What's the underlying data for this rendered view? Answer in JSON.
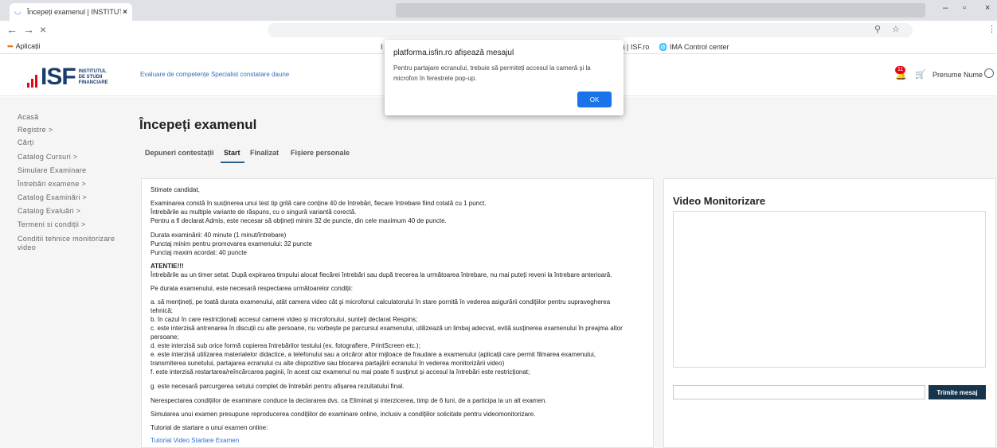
{
  "browser": {
    "tab_title": "Începeți examenul | INSTITUTUL",
    "tab_close": "×",
    "back": "←",
    "forward": "→",
    "stop": "×",
    "zoom_icon": "⚲",
    "star_icon": "☆",
    "menu_icon": "⋮",
    "win_min": "–",
    "win_max": "▫",
    "win_close": "×"
  },
  "bookmarks": {
    "apps_label": "Aplicații",
    "left_fragment": "I",
    "right_fragment": "ază | ISF.ro",
    "ima_label": "IMA Control center"
  },
  "header": {
    "logo_text": "ISF",
    "logo_line1": "INSTITUTUL",
    "logo_line2": "DE STUDII",
    "logo_line3": "FINANCIARE",
    "subtitle": "Evaluare de competențe Specialist constatare daune",
    "notification_count": "11",
    "user_name": "Prenume Nume"
  },
  "sidebar": {
    "items": [
      "Acasă",
      "Registre >",
      "Cărți",
      "Catalog Cursuri >",
      "Simulare Examinare",
      "Întrebări examene >",
      "Catalog Examinări >",
      "Catalog Evaluări >",
      "Termeni si condiții >",
      "Conditii tehnice monitorizare",
      "video"
    ]
  },
  "page": {
    "title": "Începeți examenul",
    "tabs": [
      "Depuneri contestații",
      "Start",
      "Finalizat",
      "Fișiere personale"
    ],
    "active_tab": "Start"
  },
  "instructions": {
    "lines": [
      "Stimate candidat,",
      "Examinarea constă în susținerea unui test tip grilă care conține 40 de întrebări, fiecare întrebare fiind cotată cu 1 punct.",
      "Întrebările au multiple variante de răspuns, cu o singură variantă corectă.",
      "Pentru a fi declarat Admis, este necesar să obțineți minim 32 de puncte, din cele maximum 40 de puncte.",
      "Durata examinării: 40 minute (1 minut/întrebare)",
      "Punctaj minim pentru promovarea examenului: 32 puncte",
      "Punctaj maxim acordat: 40 puncte",
      "ATENTIE!!!",
      "Întrebările au un timer setat. După expirarea timpului alocat fiecărei întrebări sau după trecerea la următoarea întrebare, nu mai puteți reveni la întrebare anterioară.",
      "Pe durata examenului, este necesară respectarea următoarelor condiții:",
      "a. să mențineți, pe toată durata examenului, atât camera video cât și microfonul calculatorului în stare pornită în vederea asigurării condițiilor pentru supravegherea",
      "tehnică;",
      "b. în cazul în care  restricționați accesul camerei video și microfonului, sunteți declarat Respins;",
      "c. este interzisă antrenarea în discuții cu alte persoane, nu vorbește pe parcursul examenului, utilizează un limbaj adecvat, evită susținerea examenului în preajma altor",
      "persoane;",
      "d. este interzisă sub orice formă copierea întrebărilor testului (ex. fotografiere, PrintScreen etc.);",
      "e. este interzisă utilizarea materialelor didactice, a telefonului sau a oricăror altor mijloace de fraudare a examenului (aplicații care permit filmarea examenului,",
      "transmiterea sunetului, partajarea ecranului cu alte dispozitive sau blocarea partajării ecranului în vederea monitorizării video)",
      "f. este interzisă restartarea/reîncărcarea paginii, în acest caz examenul nu mai poate fi susținut și accesul la întrebări este restricționat;",
      "g. este necesară parcurgerea setului complet de întrebări pentru afișarea rezultatului final.",
      "Nerespectarea condițiilor de examinare conduce la declararea dvs. ca Eliminat și interzicerea, timp de 6 luni, de a participa la un alt examen.",
      "Simularea unui examen presupune reproducerea condițiilor de examinare online, inclusiv a condițiilor solicitate pentru videomonitorizare.",
      "Tutorial de startare a unui examen online:",
      "Tutorial Video Startare Examen"
    ]
  },
  "video": {
    "title": "Video Monitorizare",
    "message_placeholder": "",
    "send_label": "Trimite mesaj"
  },
  "dialog": {
    "title": "platforma.isfin.ro afișează mesajul",
    "message_line1": "Pentru partajare ecranului, trebuie să permiteți accesul la cameră și la",
    "message_line2": "microfon în ferestrele pop-up.",
    "ok_label": "OK"
  },
  "colors": {
    "accent": "#1a73e8",
    "brand_blue": "#1b3d6d",
    "brand_red": "#e30613",
    "send_button": "#17344d"
  }
}
